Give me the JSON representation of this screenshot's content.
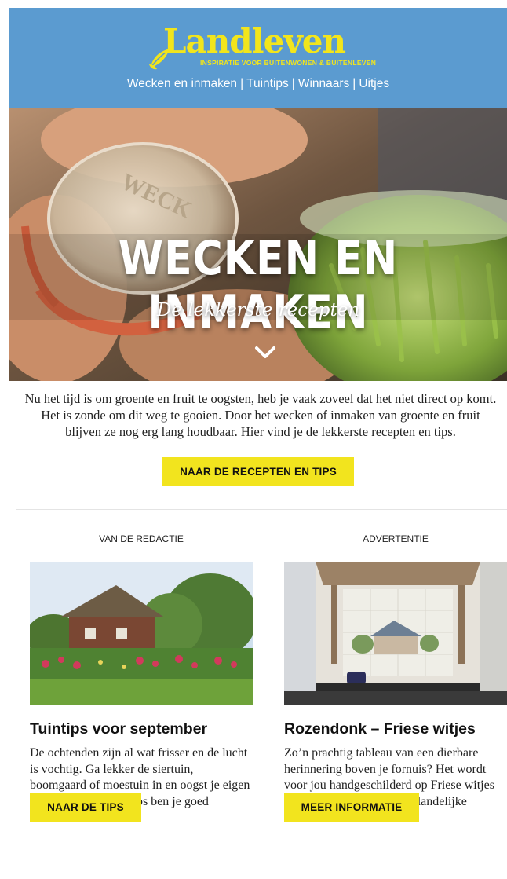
{
  "header": {
    "logo_word": "Landleven",
    "logo_tagline": "INSPIRATIE VOOR BUITENWONEN & BUITENLEVEN",
    "nav": [
      "Wecken en inmaken",
      "Tuintips",
      "Winnaars",
      "Uitjes"
    ],
    "nav_separator": "|",
    "brand_color": "#5b9bd0",
    "logo_color": "#f2e51c"
  },
  "hero": {
    "title": "WECKEN EN INMAKEN",
    "subtitle": "De lekkerste recepten",
    "jar_lid_text": "WECK",
    "icon": "chevron-down-icon"
  },
  "intro": {
    "text": "Nu het tijd is om groente en fruit te oogsten, heb je vaak zoveel dat het niet direct op komt. Het is zonde om dit weg te gooien. Door het wecken of inmaken van groente en fruit blijven ze nog erg lang houdbaar. Hier vind je de lekkerste recepten en tips.",
    "button": "NAAR DE RECEPTEN EN TIPS"
  },
  "columns": [
    {
      "label": "VAN DE REDACTIE",
      "title": "Tuintips voor september",
      "text": "De ochtenden zijn al wat frisser en de lucht is vochtig. Ga lekker de siertuin, boomgaard of moestuin in en oogst je eigen vruchten. Met deze tips ben je goed voorbereid.",
      "button": "NAAR DE TIPS"
    },
    {
      "label": "ADVERTENTIE",
      "title": "Rozendonk – Friese witjes",
      "text": "Zo’n prachtig tableau van een dierbare herinnering boven je fornuis? Het wordt voor jou handgeschilderd op Friese witjes en is een aanwinst voor je landelijke keuken.",
      "button": "MEER INFORMATIE"
    }
  ],
  "button_color": "#f2e41e"
}
